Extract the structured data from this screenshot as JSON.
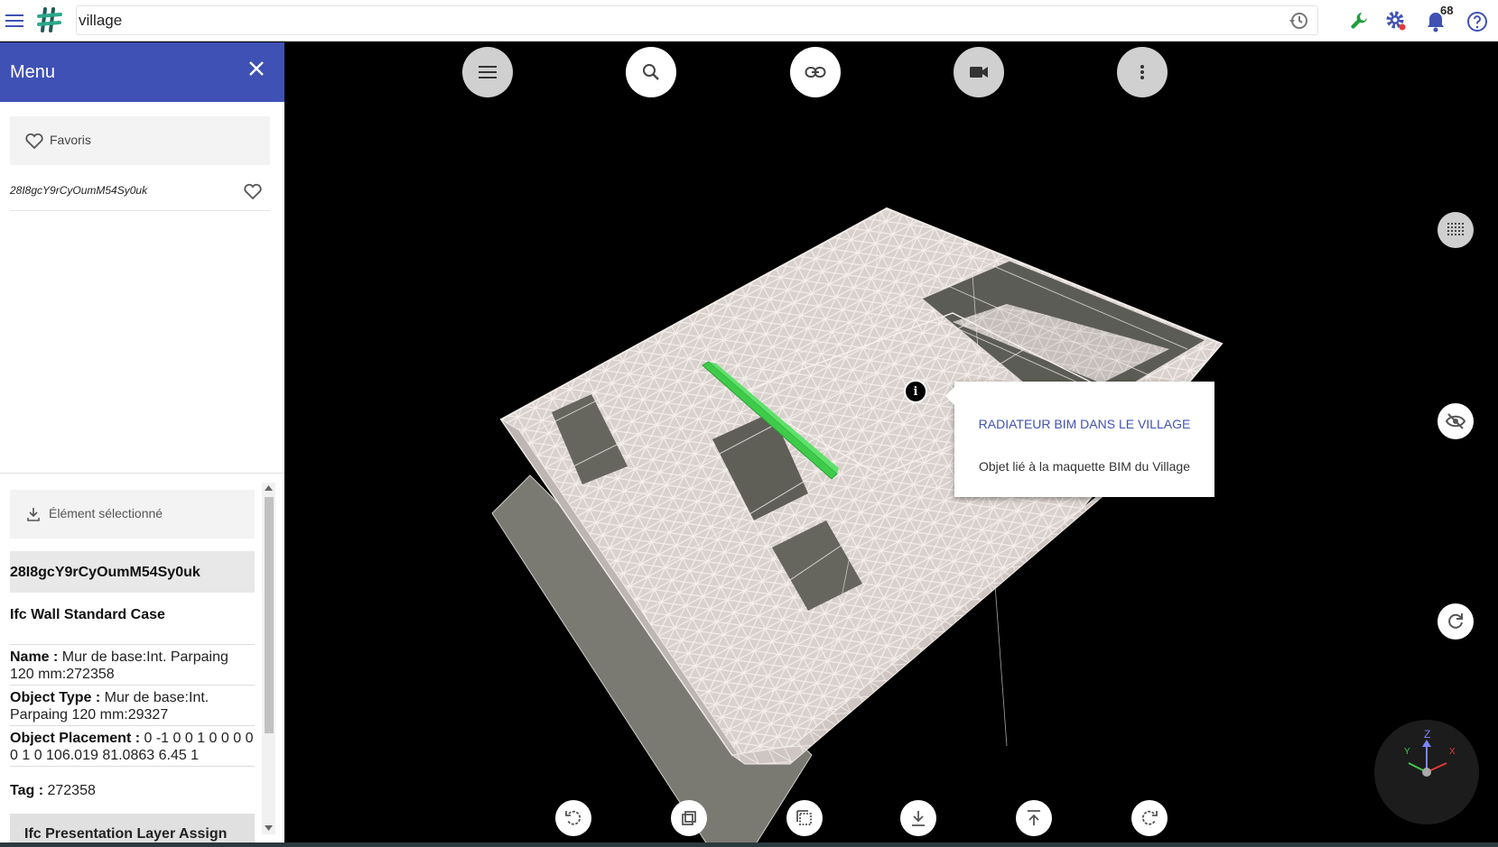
{
  "topbar": {
    "search_value": "village",
    "notification_count": "68",
    "icons": [
      "menu-icon",
      "app-logo",
      "history-icon",
      "wrench-icon",
      "settings-icon",
      "notifications-icon",
      "help-icon"
    ]
  },
  "sidebar": {
    "title": "Menu",
    "favorites_label": "Favoris",
    "favorite_items": [
      {
        "label": "28I8gcY9rCyOumM54Sy0uk"
      }
    ]
  },
  "selection": {
    "header_label": "Élément sélectionné",
    "id": "28I8gcY9rCyOumM54Sy0uk",
    "type": "Ifc Wall Standard Case",
    "properties": [
      {
        "key": "Name",
        "value": "Mur de base:Int. Parpaing 120 mm:272358"
      },
      {
        "key": "Object Type",
        "value": "Mur de base:Int. Parpaing 120 mm:29327"
      },
      {
        "key": "Object Placement",
        "value": "0 -1 0 0 1 0 0 0 0 0 1 0 106.019 81.0863 6.45 1"
      },
      {
        "key": "Tag",
        "value": "272358"
      }
    ],
    "collapsed_section": "Ifc Presentation Layer Assign"
  },
  "viewer": {
    "top_buttons": [
      "menu-icon",
      "search-icon",
      "link-icon",
      "camera-icon",
      "more-vert-icon"
    ],
    "side_buttons": [
      "grid-icon",
      "visibility-off-icon",
      "refresh-icon"
    ],
    "bottom_buttons": [
      "rotate-left-icon",
      "front-view-icon",
      "perspective-icon",
      "download-icon",
      "upload-icon",
      "rotate-right-icon"
    ],
    "popup": {
      "title": "RADIATEUR BIM DANS LE VILLAGE",
      "description": "Objet lié à la maquette BIM du Village"
    },
    "info_marker": "i",
    "axes": {
      "z": "Z",
      "y": "Y",
      "x": "X"
    },
    "colors": {
      "model": "#e8e0dc",
      "highlight": "#3ecb4a",
      "accent": "#3f51b5"
    }
  }
}
